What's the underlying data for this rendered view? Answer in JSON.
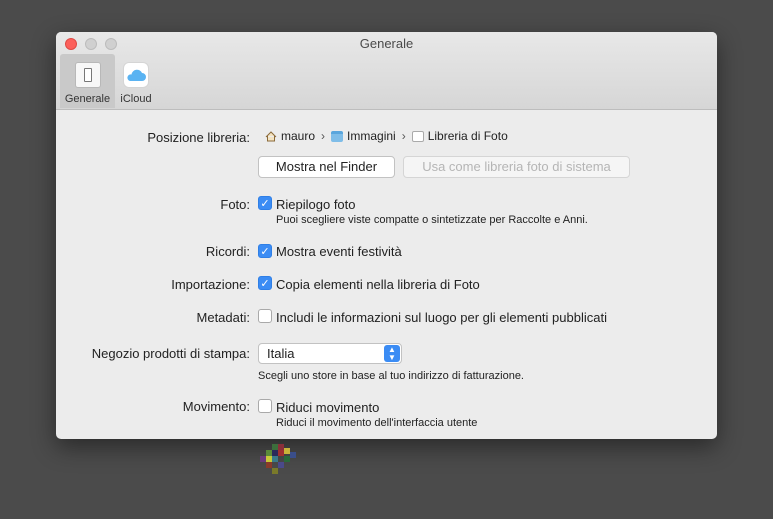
{
  "window": {
    "title": "Generale",
    "tabs": [
      {
        "label": "Generale",
        "icon": "general-switch-icon",
        "active": true
      },
      {
        "label": "iCloud",
        "icon": "icloud-icon",
        "active": false
      }
    ]
  },
  "library": {
    "label": "Posizione libreria:",
    "path": [
      "mauro",
      "Immagini",
      "Libreria di Foto"
    ],
    "show_in_finder": "Mostra nel Finder",
    "use_as_system": "Usa come libreria foto di sistema"
  },
  "photos": {
    "label": "Foto:",
    "option": "Riepilogo foto",
    "checked": true,
    "help": "Puoi scegliere viste compatte o sintetizzate per Raccolte e Anni."
  },
  "memories": {
    "label": "Ricordi:",
    "option": "Mostra eventi festività",
    "checked": true
  },
  "import": {
    "label": "Importazione:",
    "option": "Copia elementi nella libreria di Foto",
    "checked": true
  },
  "metadata": {
    "label": "Metadati:",
    "option": "Includi le informazioni sul luogo per gli elementi pubblicati",
    "checked": false
  },
  "print_store": {
    "label": "Negozio prodotti di stampa:",
    "selected": "Italia",
    "help": "Scegli uno store in base al tuo indirizzo di fatturazione."
  },
  "motion": {
    "label": "Movimento:",
    "option": "Riduci movimento",
    "checked": false,
    "help": "Riduci il movimento dell'interfaccia utente"
  },
  "colors": {
    "accent": "#3b8cf4",
    "desktop": "#4b4b4b",
    "close_button": "#fc605b"
  }
}
